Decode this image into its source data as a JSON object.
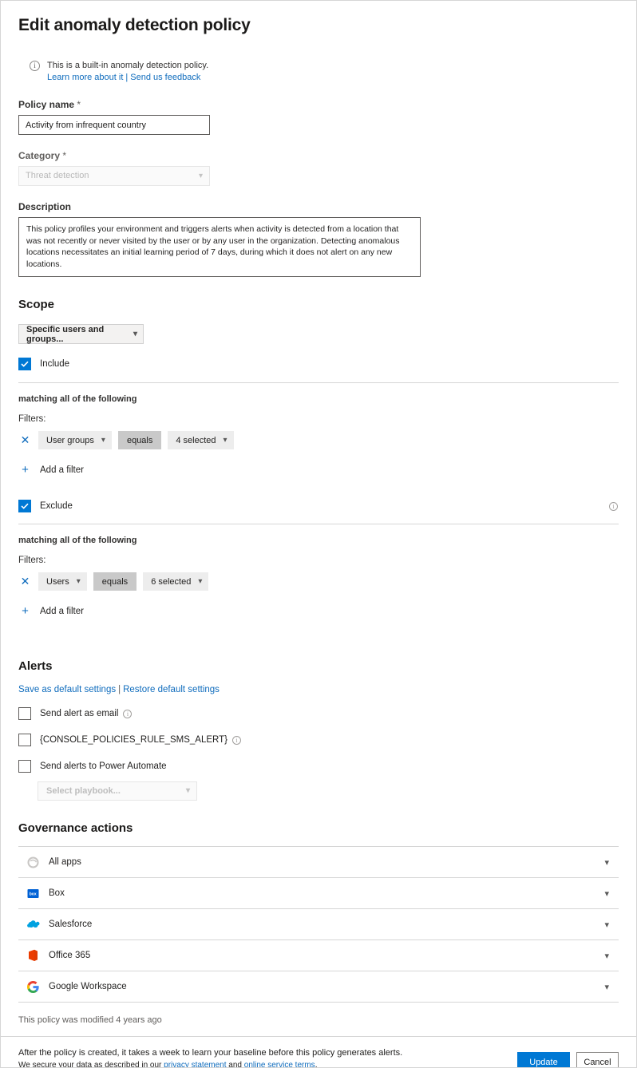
{
  "page": {
    "title": "Edit anomaly detection policy"
  },
  "banner": {
    "icon": "info-icon",
    "text": "This is a built-in anomaly detection policy.",
    "link_learn": "Learn more about it",
    "separator": "|",
    "link_feedback": "Send us feedback"
  },
  "policy_name": {
    "label": "Policy name",
    "value": "Activity from infrequent country"
  },
  "category": {
    "label": "Category",
    "value": "Threat detection",
    "disabled": true
  },
  "description": {
    "label": "Description",
    "value": "This policy profiles your environment and triggers alerts when activity is detected from a location that was not recently or never visited by the user or by any user in the organization. Detecting anomalous locations necessitates an initial learning period of 7 days, during which it does not alert on any new locations."
  },
  "scope": {
    "heading": "Scope",
    "select_value": "Specific users and groups...",
    "include": {
      "label": "Include",
      "checked": true,
      "matching": "matching all of the following",
      "filters_label": "Filters:",
      "filter": {
        "field": "User groups",
        "operator": "equals",
        "value": "4 selected"
      },
      "add_filter": "Add a filter"
    },
    "exclude": {
      "label": "Exclude",
      "checked": true,
      "matching": "matching all of the following",
      "filters_label": "Filters:",
      "filter": {
        "field": "Users",
        "operator": "equals",
        "value": "6 selected"
      },
      "add_filter": "Add a filter"
    }
  },
  "alerts": {
    "heading": "Alerts",
    "save_default": "Save as default settings",
    "separator": "|",
    "restore_default": "Restore default settings",
    "options": [
      {
        "label": "Send alert as email",
        "checked": false,
        "info": true
      },
      {
        "label": "{CONSOLE_POLICIES_RULE_SMS_ALERT}",
        "checked": false,
        "info": true
      },
      {
        "label": "Send alerts to Power Automate",
        "checked": false,
        "info": false
      }
    ],
    "playbook_placeholder": "Select playbook..."
  },
  "governance": {
    "heading": "Governance actions",
    "rows": [
      {
        "name": "All apps",
        "icon": "all-apps-icon"
      },
      {
        "name": "Box",
        "icon": "box-icon"
      },
      {
        "name": "Salesforce",
        "icon": "salesforce-icon"
      },
      {
        "name": "Office 365",
        "icon": "office365-icon"
      },
      {
        "name": "Google Workspace",
        "icon": "google-workspace-icon"
      }
    ]
  },
  "footer": {
    "modified": "This policy was modified 4 years ago",
    "note_line1": "After the policy is created, it takes a week to learn your baseline before this policy generates alerts.",
    "note_line2_pre": "We secure your data as described in our ",
    "note_link1": "privacy statement",
    "note_line2_mid": " and ",
    "note_link2": "online service terms",
    "note_line2_end": ".",
    "update": "Update",
    "cancel": "Cancel"
  },
  "colors": {
    "accent": "#0078d4",
    "link": "#0f6cbd",
    "border": "#d6d6d6",
    "chip": "#ededed",
    "chip_mid": "#c9c9c9"
  }
}
